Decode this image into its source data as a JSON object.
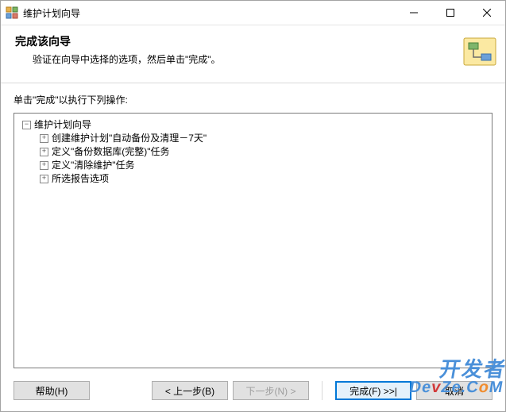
{
  "window": {
    "title": "维护计划向导"
  },
  "header": {
    "title": "完成该向导",
    "subtitle": "验证在向导中选择的选项，然后单击\"完成\"。"
  },
  "body": {
    "instruction": "单击\"完成\"以执行下列操作:"
  },
  "tree": {
    "root": {
      "toggle": "−",
      "label": "维护计划向导"
    },
    "children": [
      {
        "toggle": "+",
        "label": "创建维护计划\"自动备份及清理－7天\""
      },
      {
        "toggle": "+",
        "label": "定义\"备份数据库(完整)\"任务"
      },
      {
        "toggle": "+",
        "label": "定义\"清除维护\"任务"
      },
      {
        "toggle": "+",
        "label": "所选报告选项"
      }
    ]
  },
  "buttons": {
    "help": "帮助(H)",
    "back": "< 上一步(B)",
    "next": "下一步(N) >",
    "finish": "完成(F) >>|",
    "cancel": "取消"
  },
  "watermark": {
    "cn": "开发者",
    "en_pre": "De",
    "en_v": "v",
    "en_mid": "Ze.C",
    "en_o": "o",
    "en_post": "M"
  }
}
